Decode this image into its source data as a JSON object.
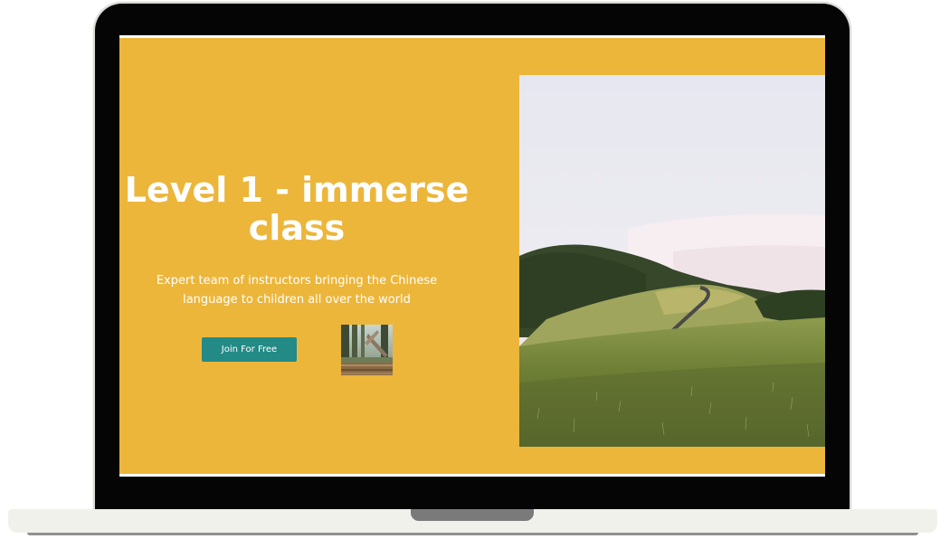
{
  "hero": {
    "title": "Level 1 - immerse class",
    "subtitle": "Expert team of instructors bringing the Chinese language to children all over the world",
    "cta_label": "Join For Free"
  },
  "colors": {
    "background": "#ecb63b",
    "button": "#238a86",
    "text": "#ffffff",
    "laptop_frame": "#050505",
    "laptop_base": "#f1f1ec"
  },
  "images": {
    "thumbnail": "forest-photo",
    "main": "hillside-road-landscape-photo"
  }
}
